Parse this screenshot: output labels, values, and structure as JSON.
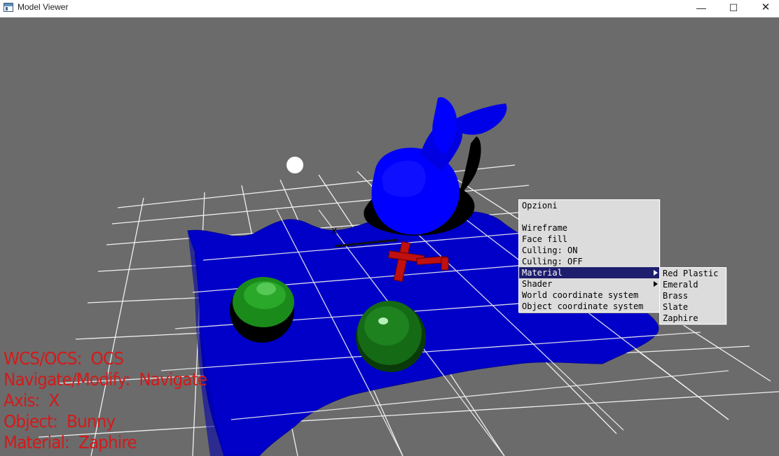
{
  "window": {
    "title": "Model Viewer",
    "minimize_glyph": "—",
    "maximize_glyph": "☐",
    "close_glyph": "✕"
  },
  "context_menu": {
    "title": "Opzioni",
    "items": [
      {
        "label": "Wireframe"
      },
      {
        "label": "Face fill"
      },
      {
        "label": "Culling: ON"
      },
      {
        "label": "Culling: OFF"
      },
      {
        "label": "Material",
        "submenu": true,
        "highlighted": true
      },
      {
        "label": "Shader",
        "submenu": true
      },
      {
        "label": "World coordinate system"
      },
      {
        "label": "Object coordinate system"
      }
    ]
  },
  "material_submenu": {
    "items": [
      "Red Plastic",
      "Emerald",
      "Brass",
      "Slate",
      "Zaphire"
    ]
  },
  "hud": {
    "wcs_ocs": "WCS/OCS:  OCS",
    "navigate_modify": "Navigate/Modify:  Navigate",
    "axis": "Axis:  X",
    "object": "Object:  Bunny",
    "material": "Material:  Zaphire"
  },
  "colors": {
    "background": "#6b6b6b",
    "hud_text": "#d41a1a",
    "menu_bg": "#dcdcdc",
    "menu_highlight": "#1e1e6e",
    "surface": "#0000c8",
    "bunny": "#0000ff",
    "sphere": "#1a8a1a",
    "gizmo": "#c01010"
  }
}
